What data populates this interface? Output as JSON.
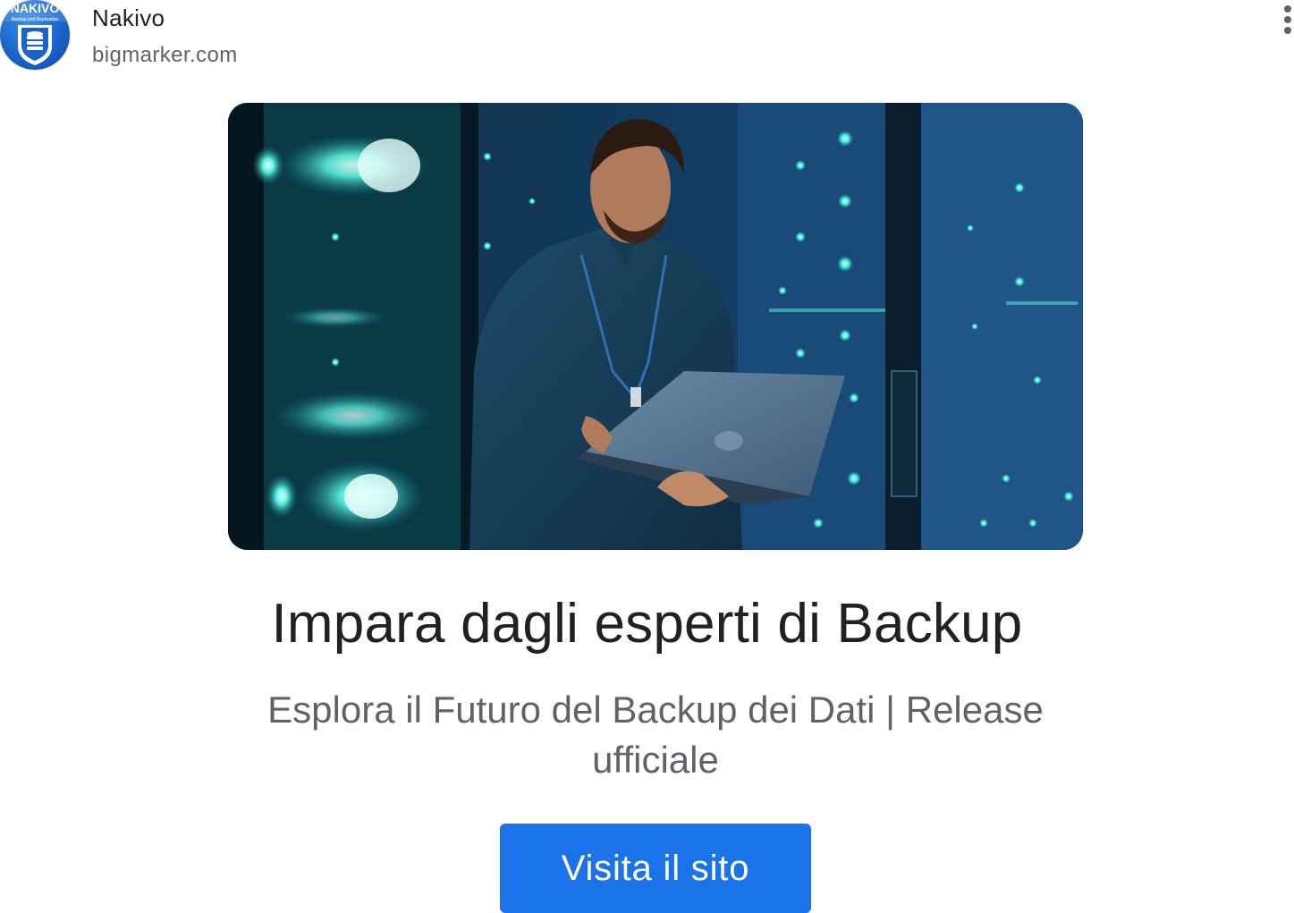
{
  "advertiser": {
    "name": "Nakivo",
    "domain": "bigmarker.com",
    "logo_text": "NAKIVO",
    "logo_subtext": "Backup and Replication",
    "logo_icon": "database-shield-icon"
  },
  "menu": {
    "icon": "more-vert-icon"
  },
  "hero_image": {
    "description": "man-with-laptop-in-server-room"
  },
  "headline": "Impara dagli esperti di Backup",
  "description": "Esplora il Futuro del Backup dei Dati | Release ufficiale",
  "cta": {
    "label": "Visita il sito"
  },
  "colors": {
    "cta_background": "#1a73e8",
    "cta_text": "#ffffff",
    "headline": "#202124",
    "secondary_text": "#5f6368",
    "logo_blue": "#1a63c9"
  }
}
